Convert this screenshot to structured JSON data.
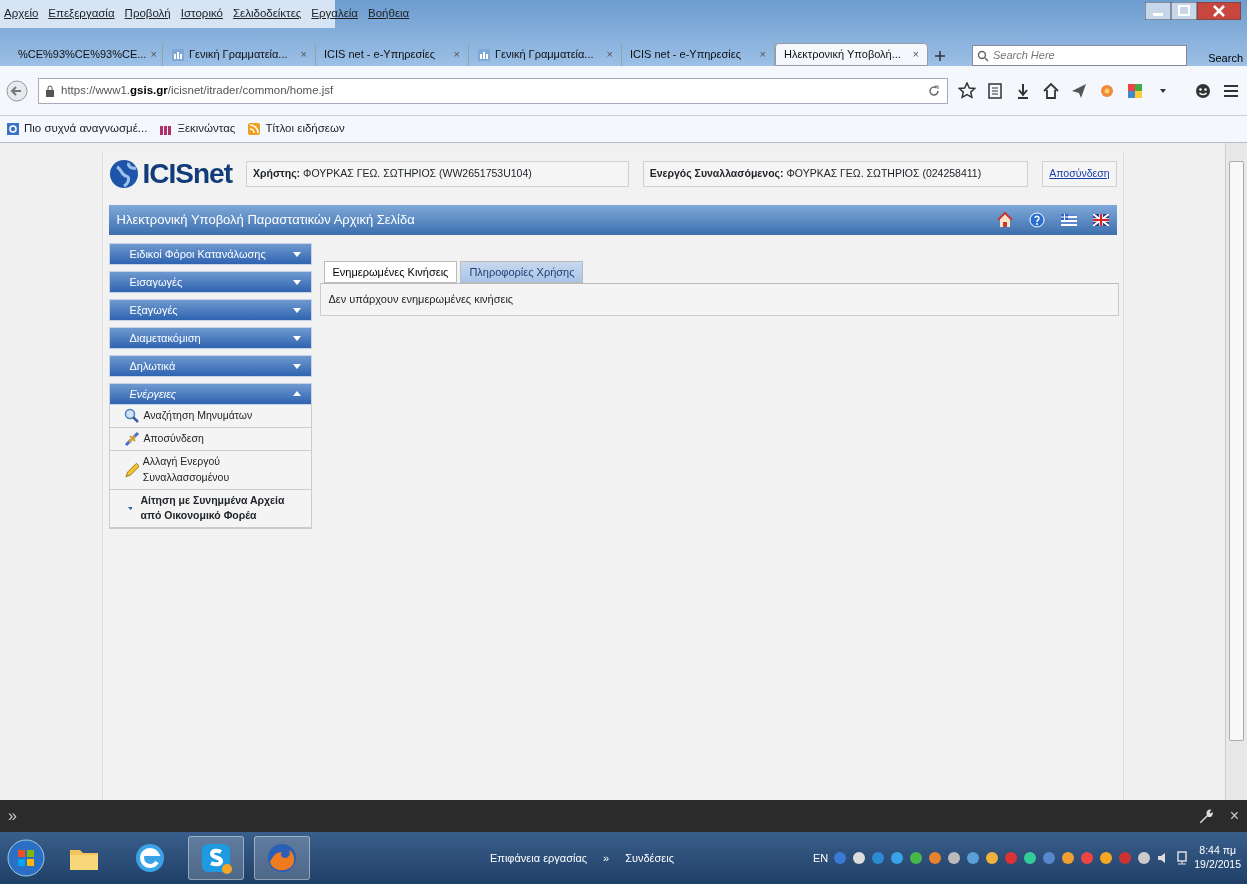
{
  "menu_bar": [
    "Αρχείο",
    "Επεξεργασία",
    "Προβολή",
    "Ιστορικό",
    "Σελιδοδείκτες",
    "Εργαλεία",
    "Βοήθεια"
  ],
  "browser_tabs": [
    {
      "label": "%CE%93%CE%93%CE...",
      "close": "×",
      "has_icon": false,
      "selected": false
    },
    {
      "label": "Γενική Γραμματεία...",
      "close": "×",
      "has_icon": true,
      "selected": false
    },
    {
      "label": "ICIS net - e-Υπηρεσίες",
      "close": "×",
      "has_icon": false,
      "selected": false
    },
    {
      "label": "Γενική Γραμματεία...",
      "close": "×",
      "has_icon": true,
      "selected": false
    },
    {
      "label": "ICIS net - e-Υπηρεσίες",
      "close": "×",
      "has_icon": false,
      "selected": false
    },
    {
      "label": "Ηλεκτρονική Υποβολή...",
      "close": "×",
      "has_icon": false,
      "selected": true
    }
  ],
  "search": {
    "placeholder": "Search Here",
    "button": "Search"
  },
  "address": {
    "url": "https://www1.**gsis.gr**/icisnet/itrader/common/home.jsf"
  },
  "bookmarks": [
    "Πιο συχνά αναγνωσμέ...",
    "Ξεκινώντας",
    "Τίτλοι ειδήσεων"
  ],
  "page": {
    "logo": "ICISnet",
    "user_label": "Χρήστης:",
    "user_value": "ΦΟΥΡΚΑΣ ΓΕΩ. ΣΩΤΗΡΙΟΣ (WW2651753U104)",
    "trader_label": "Ενεργός Συναλλασόμενος:",
    "trader_value": "ΦΟΥΡΚΑΣ ΓΕΩ. ΣΩΤΗΡΙΟΣ (024258411)",
    "logout": "Αποσύνδεση",
    "title": "Ηλεκτρονική Υποβολή Παραστατικών Αρχική Σελίδα",
    "sidebar": [
      {
        "label": "Ειδικοί Φόροι Κατανάλωσης",
        "expanded": false
      },
      {
        "label": "Εισαγωγές",
        "expanded": false
      },
      {
        "label": "Εξαγωγές",
        "expanded": false
      },
      {
        "label": "Διαμετακόμιση",
        "expanded": false
      },
      {
        "label": "Δηλωτικά",
        "expanded": false
      },
      {
        "label": "Ενέργειες",
        "expanded": true,
        "items": [
          {
            "kind": "search",
            "label": "Αναζήτηση Μηνυμάτων"
          },
          {
            "kind": "disconnect",
            "label": "Αποσύνδεση"
          },
          {
            "kind": "edit",
            "label": "Αλλαγή Ενεργού Συναλλασσομένου"
          },
          {
            "kind": "submenu",
            "label": "Αίτηση με Συνημμένα Αρχεία από Οικονομικό Φορέα"
          }
        ]
      }
    ],
    "tabs": [
      {
        "label": "Ενημερωμένες Κινήσεις",
        "selected": true
      },
      {
        "label": "Πληροφορίες Χρήσης",
        "selected": false
      }
    ],
    "message": "Δεν υπάρχουν ενημερωμένες κινήσεις"
  },
  "dev_bar": {
    "left": "»",
    "close": "×"
  },
  "taskbar": {
    "toolbar_1": "Επιφάνεια εργασίας",
    "chevron": "»",
    "toolbar_2": "Συνδέσεις",
    "language": "EN",
    "time": "8:44 πμ",
    "date": "19/2/2015"
  }
}
